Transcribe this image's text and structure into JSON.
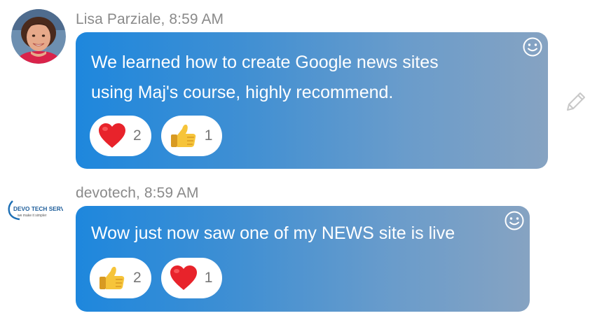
{
  "messages": [
    {
      "author": "Lisa Parziale",
      "time": "8:59 AM",
      "header": "Lisa Parziale, 8:59 AM",
      "avatar_icon": "user-photo-avatar",
      "lines": [
        "We learned how to create Google news sites",
        "using Maj's course, highly recommend."
      ],
      "reactions": [
        {
          "icon": "heart-icon",
          "count": "2"
        },
        {
          "icon": "thumbs-up-icon",
          "count": "1"
        }
      ]
    },
    {
      "author": "devotech",
      "time": "8:59 AM",
      "header": "devotech, 8:59 AM",
      "avatar_icon": "devo-tech-logo",
      "avatar_logo_text": "DEVO TECH SERVICE",
      "avatar_logo_tagline": "we make it simpler",
      "lines": [
        "Wow just now saw one of my NEWS site is live"
      ],
      "reactions": [
        {
          "icon": "thumbs-up-icon",
          "count": "2"
        },
        {
          "icon": "heart-icon",
          "count": "1"
        }
      ]
    }
  ],
  "icons": {
    "add_reaction": "smiley-icon",
    "edit": "pencil-icon"
  },
  "colors": {
    "bubble_start": "#1e87dd",
    "bubble_end": "#86a3c2",
    "meta_text": "#8a8a8a",
    "count_text": "#777777",
    "heart": "#e8232b",
    "thumb": "#f6c43a"
  }
}
